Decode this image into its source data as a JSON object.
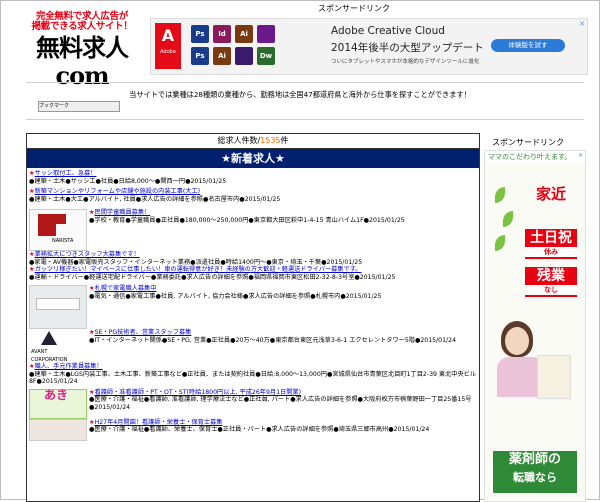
{
  "header": {
    "logo_tagline_1": "完全無料で求人広告が",
    "logo_tagline_2": "掲載できる求人サイト！",
    "logo_main": "無料求人com",
    "sponsor_label": "スポンサードリンク"
  },
  "ad_banner": {
    "brand": "Adobe",
    "title": "Adobe Creative Cloud",
    "subtitle": "2014年後半の大型アップデート",
    "small": "ついにタブレットやスマホが本格的なデザインツールに進化",
    "button": "体験版を試す",
    "icons": [
      {
        "label": "Ps",
        "color": "#1a3a8a"
      },
      {
        "label": "Id",
        "color": "#8a1a5a"
      },
      {
        "label": "Ai",
        "color": "#7a3a10"
      },
      {
        "label": "",
        "color": "#6a1a8a"
      },
      {
        "label": "Ps",
        "color": "#1a3a8a"
      },
      {
        "label": "Ai",
        "color": "#7a3a10"
      },
      {
        "label": "",
        "color": "#3a1a6a"
      },
      {
        "label": "Dw",
        "color": "#2a6a2a"
      }
    ]
  },
  "site_desc": "当サイトでは業種は28種類の業種から、勤務地は全国47都道府県と海外から仕事を探すことができます！",
  "bookmark": "ブックマーク",
  "main": {
    "count_label": "総求人件数/",
    "count_value": "1535",
    "count_unit": "件",
    "new_title": "★新着求人★"
  },
  "entries": [
    {
      "title": "サッシ取付工、急募！",
      "body": "●建築・土木●サッシ工●社員●日給8,000〜●関西一円●2015/01/25"
    },
    {
      "title": "新築マンションやリフォームや店舗や施設の内装工事(大工)",
      "body": "●建築・土木●大工●アルバイト, 社員●求人広告の詳細を参照●名古屋市内●2015/01/25"
    },
    {
      "title": "民間学童職員募集！",
      "body": "●学校・教育●学童職員●正社員●180,000〜250,000円●東京都大田区萩中1-4-15 青山ハイム1F●2015/01/25",
      "thumb": "NARISTA"
    },
    {
      "title": "業務拡大につきスタッフ大募集です！",
      "body": "●家電・AV機器●家電販売スタッフ・インターネット業務●派遣社員●時給1400円〜●東京・埼玉・千葉●2015/01/25"
    },
    {
      "title": "ガッツリ稼ぎたい！マイペースに仕事したい！車の運転得意が好き！未経験の方大歓迎・軽運送ドライバー募集です。",
      "body": "●運輸・ドライバー●軽運送宅配ドライバー●業務委託●求人広告の詳細を参照●福岡県福岡市東区松田2-32-8-3号室●2015/01/25"
    },
    {
      "title": "札幌で家電職人募集中",
      "body": "●電気・通信●家電工事●社員, アルバイト, 協力会社様●求人広告の詳細を参照●札幌市内●2015/01/25"
    },
    {
      "title": "SE・PG技術者、営業スタッフ募集",
      "body": "●IT・インターネット関係●SE・PG, 営業●正社員●20万〜40万●東京都台東区元浅草3-6-1 エクセレントタワー5階●2015/01/24",
      "thumb": "AVANT CORPORATION"
    },
    {
      "title": "職人、手元作業員募集！",
      "body": "●建築・土木●LGS内装工事、土木工事、新築工事など●正社員、または契約社員●日給:8,000〜13,000円●宮城県仙台市青葉区北目町1丁目2-39 東北中央ビル8F●2015/01/24"
    },
    {
      "title": "看護師・准看護師・PT・OT・ST(時給1800円以上, 平成26年9月1日開業)",
      "body": "●医療・介護・福祉●看護師, 准看護師, 理学療法士など●正社員, パート●求人広告の詳細を参照●大阪府枚方市楠葉野田一丁目25番15号●2015/01/24",
      "thumb": "あき"
    },
    {
      "title": "H27年4月開園！看護師・栄養士・保育士募集",
      "body": "●医療・介護・福祉●看護師、栄養士、保育士●正社員・パート●求人広告の詳細を参照●埼玉県三郷市高州●2015/01/24"
    }
  ],
  "sidebar": {
    "sponsor_label": "スポンサードリンク",
    "ad_top": "ママのこだわり叶えます。",
    "line1": "家近",
    "line2": "土日祝",
    "line2_sub": "休み",
    "line3": "残業",
    "line3_sub": "なし",
    "bottom1": "薬剤師の",
    "bottom2": "転職なら"
  }
}
